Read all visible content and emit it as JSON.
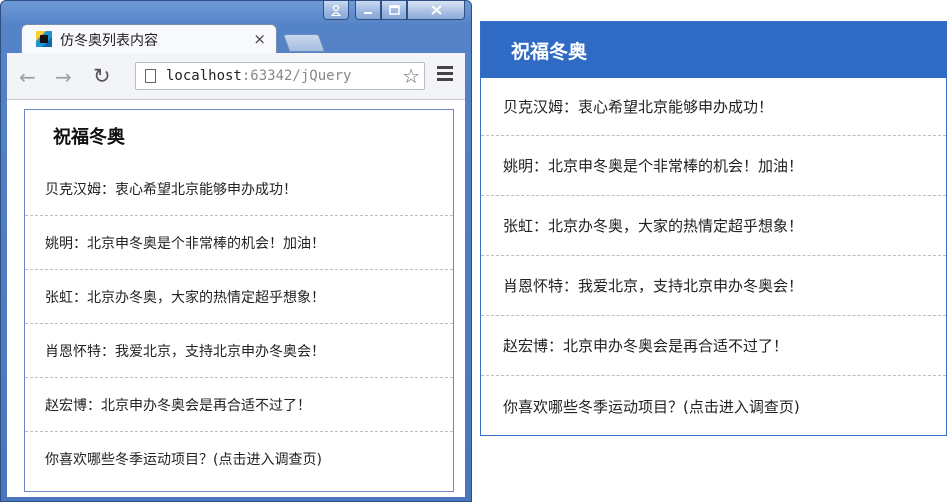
{
  "browser": {
    "tab_title": "仿冬奥列表内容",
    "tab_close": "×",
    "url_host": "localhost",
    "url_rest": ":63342/jQuery",
    "back": "←",
    "forward": "→",
    "reload": "↻",
    "star": "☆"
  },
  "panel": {
    "title": "祝福冬奥",
    "items": [
      "贝克汉姆：衷心希望北京能够申办成功！",
      "姚明：北京申冬奥是个非常棒的机会！加油！",
      "张虹：北京办冬奥，大家的热情定超乎想象！",
      "肖恩怀特：我爱北京，支持北京申办冬奥会！",
      "赵宏博：北京申办冬奥会是再合适不过了！",
      "你喜欢哪些冬季运动项目？(点击进入调查页)"
    ]
  },
  "colors": {
    "header_blue": "#2f6bc4",
    "border_blue": "#3a6fc6"
  }
}
